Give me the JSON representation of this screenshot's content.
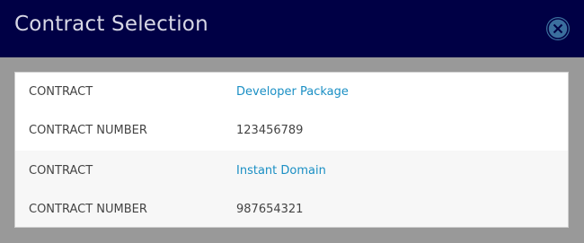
{
  "dialog": {
    "title": "Contract Selection",
    "close_icon": "close-circle-icon"
  },
  "contracts": [
    {
      "contract_label": "CONTRACT",
      "contract_name": "Developer Package",
      "number_label": "CONTRACT NUMBER",
      "contract_number": "123456789"
    },
    {
      "contract_label": "CONTRACT",
      "contract_name": "Instant Domain",
      "number_label": "CONTRACT NUMBER",
      "contract_number": "987654321"
    }
  ],
  "colors": {
    "header_bg": "#000045",
    "link": "#1a8fc4",
    "close_button": "#3b6f9e",
    "overlay": "#999999"
  }
}
